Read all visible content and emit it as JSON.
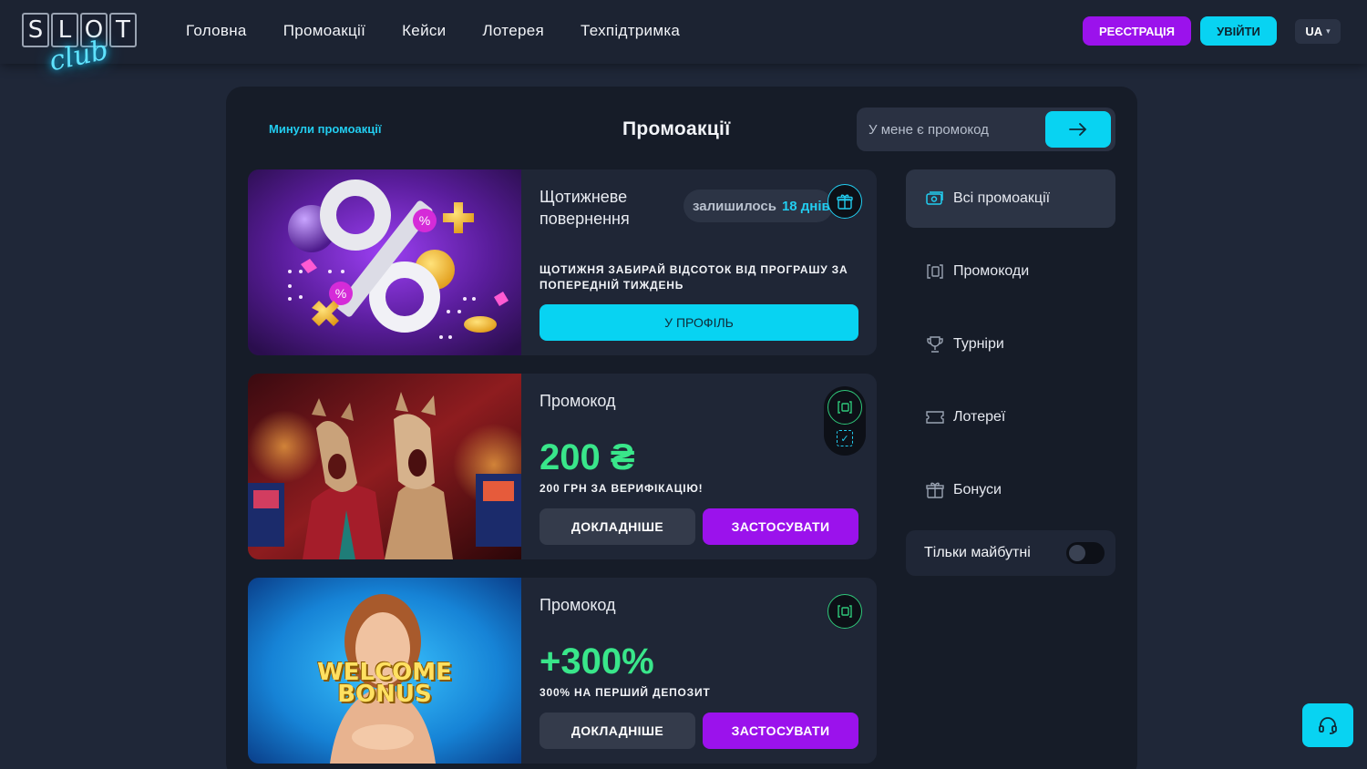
{
  "header": {
    "logo": {
      "letters": [
        "S",
        "L",
        "O",
        "T"
      ],
      "sub": "club"
    },
    "nav": [
      "Головна",
      "Промоакції",
      "Кейси",
      "Лотерея",
      "Техпідтримка"
    ],
    "register_label": "РЕЄСТРАЦІЯ",
    "login_label": "УВІЙТИ",
    "language": "UA"
  },
  "main": {
    "past_link": "Минули промоакції",
    "title": "Промоакції",
    "promo_placeholder": "У мене є промокод"
  },
  "cards": [
    {
      "kind": "Щотижневе повернення",
      "remaining_label": "залишилось",
      "remaining_value": "18 днів",
      "description": "ЩОТИЖНЯ ЗАБИРАЙ ВІДСОТОК ВІД ПРОГРАШУ ЗА ПОПЕРЕДНІЙ ТИЖДЕНЬ",
      "button": "У ПРОФІЛЬ",
      "icon": "gift-icon"
    },
    {
      "kind": "Промокод",
      "amount": "200 ₴",
      "description": "200 ГРН ЗА ВЕРИФІКАЦІЮ!",
      "more_label": "ДОКЛАДНІШЕ",
      "apply_label": "ЗАСТОСУВАТИ",
      "icon": "promocode-icon"
    },
    {
      "kind": "Промокод",
      "amount": "+300%",
      "description": "300% НА ПЕРШИЙ ДЕПОЗИТ",
      "more_label": "ДОКЛАДНІШЕ",
      "apply_label": "ЗАСТОСУВАТИ",
      "image_text": "WELCOME BONUS",
      "icon": "promocode-icon"
    }
  ],
  "sidebar": {
    "items": [
      {
        "label": "Всі промоакції",
        "icon": "all-promos-icon",
        "active": true
      },
      {
        "label": "Промокоди",
        "icon": "promocode-icon",
        "active": false
      },
      {
        "label": "Турніри",
        "icon": "trophy-icon",
        "active": false
      },
      {
        "label": "Лотереї",
        "icon": "ticket-icon",
        "active": false
      },
      {
        "label": "Бонуси",
        "icon": "gift-icon",
        "active": false
      }
    ],
    "future_only_label": "Тільки майбутні",
    "future_only_on": false
  },
  "colors": {
    "accent_cyan": "#08d3f2",
    "accent_purple": "#9b12ec",
    "accent_green": "#39e68a",
    "background": "#1f2738"
  }
}
